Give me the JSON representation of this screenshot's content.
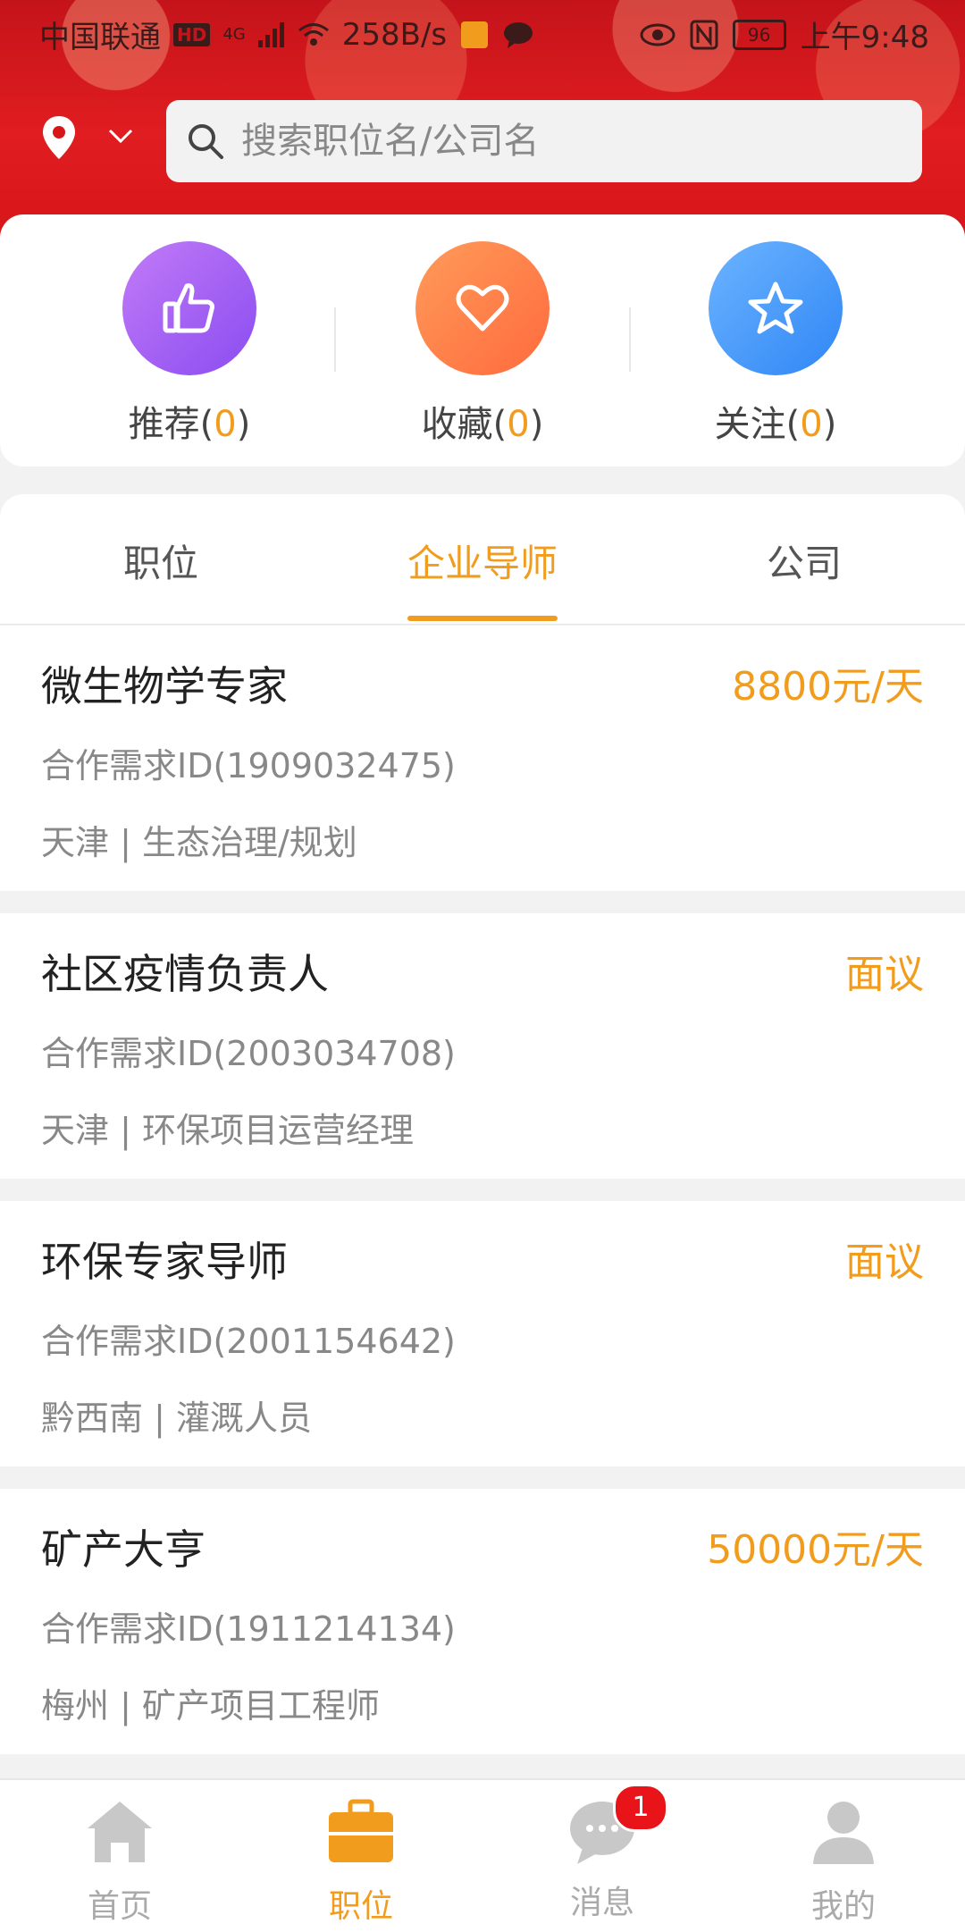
{
  "status_bar": {
    "carrier": "中国联通",
    "hd": "HD",
    "network": "4G",
    "speed": "258B/s",
    "battery": "96",
    "time": "上午9:48"
  },
  "search": {
    "placeholder": "搜索职位名/公司名"
  },
  "quick_actions": [
    {
      "label": "推荐",
      "count": "0",
      "icon": "thumbs-up-icon",
      "color": "#9b59f0"
    },
    {
      "label": "收藏",
      "count": "0",
      "icon": "heart-icon",
      "color": "#ff7a45"
    },
    {
      "label": "关注",
      "count": "0",
      "icon": "star-icon",
      "color": "#3f8ff5"
    }
  ],
  "tabs": [
    {
      "label": "职位",
      "active": false
    },
    {
      "label": "企业导师",
      "active": true
    },
    {
      "label": "公司",
      "active": false
    }
  ],
  "listings": [
    {
      "title": "微生物学专家",
      "pay": "8800元/天",
      "id": "合作需求ID(1909032475)",
      "meta": "天津 | 生态治理/规划"
    },
    {
      "title": "社区疫情负责人",
      "pay": "面议",
      "id": "合作需求ID(2003034708)",
      "meta": "天津 | 环保项目运营经理"
    },
    {
      "title": "环保专家导师",
      "pay": "面议",
      "id": "合作需求ID(2001154642)",
      "meta": "黔西南 | 灌溉人员"
    },
    {
      "title": "矿产大亨",
      "pay": "50000元/天",
      "id": "合作需求ID(1911214134)",
      "meta": "梅州 | 矿产项目工程师"
    }
  ],
  "bottom_nav": [
    {
      "label": "首页",
      "icon": "home-icon",
      "active": false
    },
    {
      "label": "职位",
      "icon": "briefcase-icon",
      "active": true
    },
    {
      "label": "消息",
      "icon": "chat-icon",
      "active": false,
      "badge": "1"
    },
    {
      "label": "我的",
      "icon": "user-icon",
      "active": false
    }
  ],
  "colors": {
    "accent": "#f29c1e",
    "header_red": "#d7161a",
    "badge_red": "#e8141a"
  }
}
